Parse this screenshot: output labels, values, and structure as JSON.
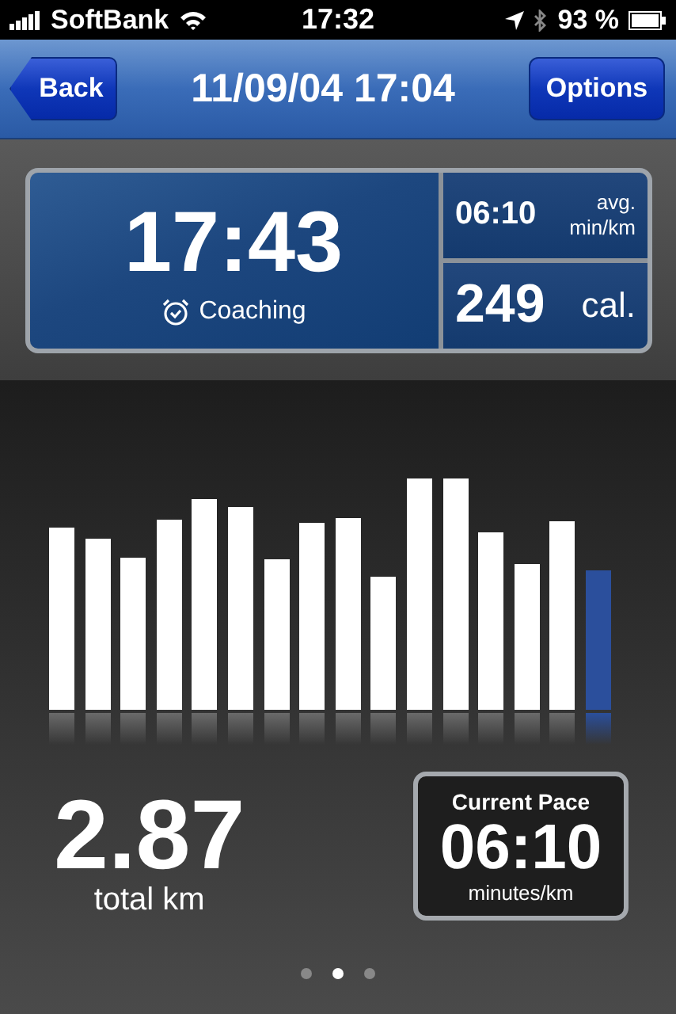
{
  "status_bar": {
    "carrier": "SoftBank",
    "time": "17:32",
    "battery": "93 %"
  },
  "nav": {
    "back": "Back",
    "title": "11/09/04 17:04",
    "options": "Options"
  },
  "summary": {
    "duration": "17:43",
    "mode": "Coaching",
    "avg_pace": "06:10",
    "avg_unit_1": "avg.",
    "avg_unit_2": "min/km",
    "calories": "249",
    "calories_unit": "cal."
  },
  "bars": [
    {
      "selected": false
    },
    {
      "selected": false
    },
    {
      "selected": false
    },
    {
      "selected": false
    },
    {
      "selected": false
    },
    {
      "selected": false
    },
    {
      "selected": false
    },
    {
      "selected": false
    },
    {
      "selected": false
    },
    {
      "selected": false
    },
    {
      "selected": false
    },
    {
      "selected": false
    },
    {
      "selected": false
    },
    {
      "selected": false
    },
    {
      "selected": false
    },
    {
      "selected": true
    }
  ],
  "distance": {
    "value": "2.87",
    "unit": "total km"
  },
  "current_pace": {
    "label": "Current Pace",
    "value": "06:10",
    "unit": "minutes/km"
  },
  "pages": [
    {
      "selected": false
    },
    {
      "selected": true
    },
    {
      "selected": false
    }
  ]
}
